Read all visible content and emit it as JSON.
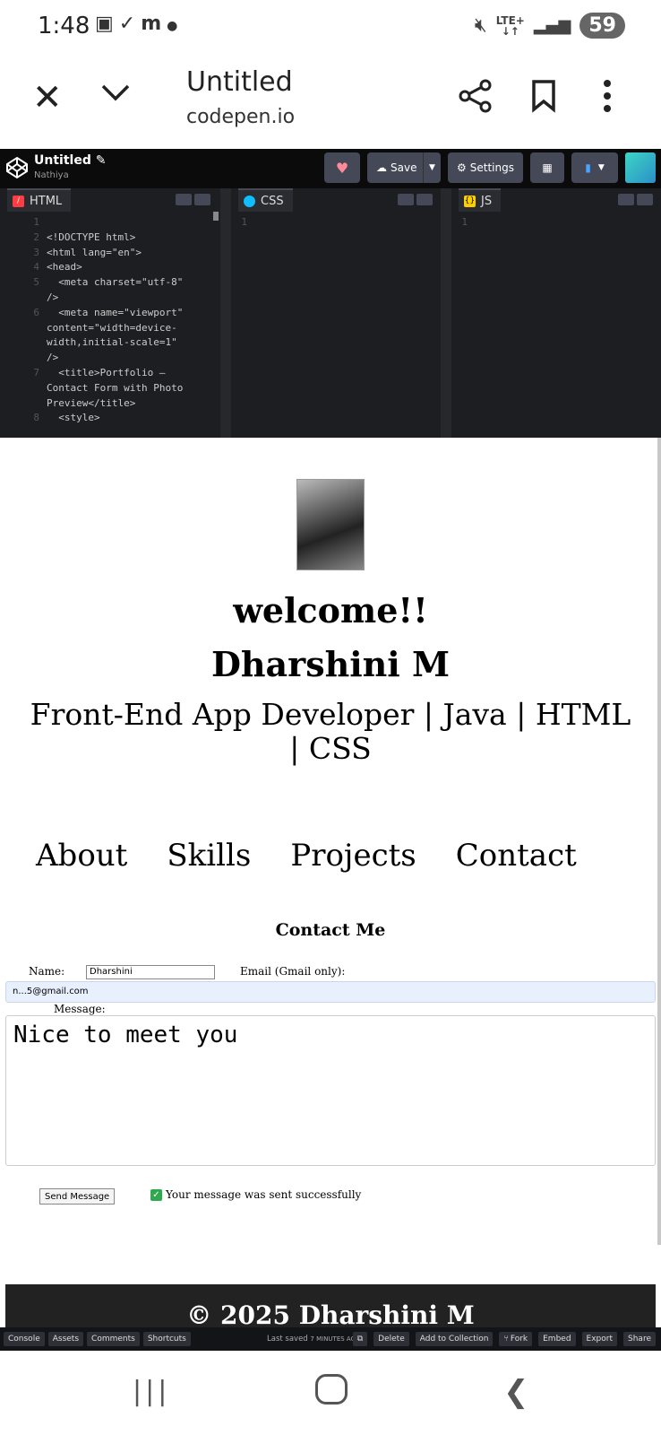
{
  "status_bar": {
    "time": "1:48",
    "left_icons": [
      "screenshot-icon",
      "check-icon",
      "m-icon",
      "dot-icon"
    ],
    "network": "LTE+",
    "battery": "59"
  },
  "browser": {
    "title": "Untitled",
    "url": "codepen.io"
  },
  "codepen": {
    "pen_title": "Untitled",
    "owner": "Nathiya",
    "save_label": "Save",
    "settings_label": "Settings",
    "panes": {
      "html": "HTML",
      "css": "CSS",
      "js": "JS"
    },
    "html_code": [
      {
        "n": "1",
        "t": ""
      },
      {
        "n": "2",
        "t": "<!DOCTYPE html>"
      },
      {
        "n": "3",
        "t": "<html lang=\"en\">"
      },
      {
        "n": "4",
        "t": "<head>"
      },
      {
        "n": "5",
        "t": "  <meta charset=\"utf-8\""
      },
      {
        "n": "",
        "t": "/>"
      },
      {
        "n": "6",
        "t": "  <meta name=\"viewport\""
      },
      {
        "n": "",
        "t": "content=\"width=device-"
      },
      {
        "n": "",
        "t": "width,initial-scale=1\""
      },
      {
        "n": "",
        "t": "/>"
      },
      {
        "n": "7",
        "t": "  <title>Portfolio —"
      },
      {
        "n": "",
        "t": "Contact Form with Photo"
      },
      {
        "n": "",
        "t": "Preview</title>"
      },
      {
        "n": "8",
        "t": "  <style>"
      }
    ],
    "css_line": "1",
    "js_line": "1",
    "bottom_left": [
      "Console",
      "Assets",
      "Comments",
      "Shortcuts"
    ],
    "last_saved_label": "Last saved",
    "last_saved_time": "7 MINUTES AGO",
    "bottom_right": [
      "Delete",
      "Add to Collection",
      "Fork",
      "Embed",
      "Export",
      "Share"
    ]
  },
  "preview": {
    "welcome": "welcome!!",
    "name": "Dharshini M",
    "role": "Front-End App Developer | Java | HTML | CSS",
    "nav": [
      "About",
      "Skills",
      "Projects",
      "Contact"
    ],
    "contact_title": "Contact Me",
    "name_label": "Name:",
    "name_value": "Dharshini",
    "email_label": "Email (Gmail only):",
    "email_value": "n...5@gmail.com",
    "message_label": "Message:",
    "message_value": "Nice to meet you",
    "send_label": "Send Message",
    "success_text": "Your message was sent successfully",
    "footer_text": "© 2025 Dharshini M"
  }
}
